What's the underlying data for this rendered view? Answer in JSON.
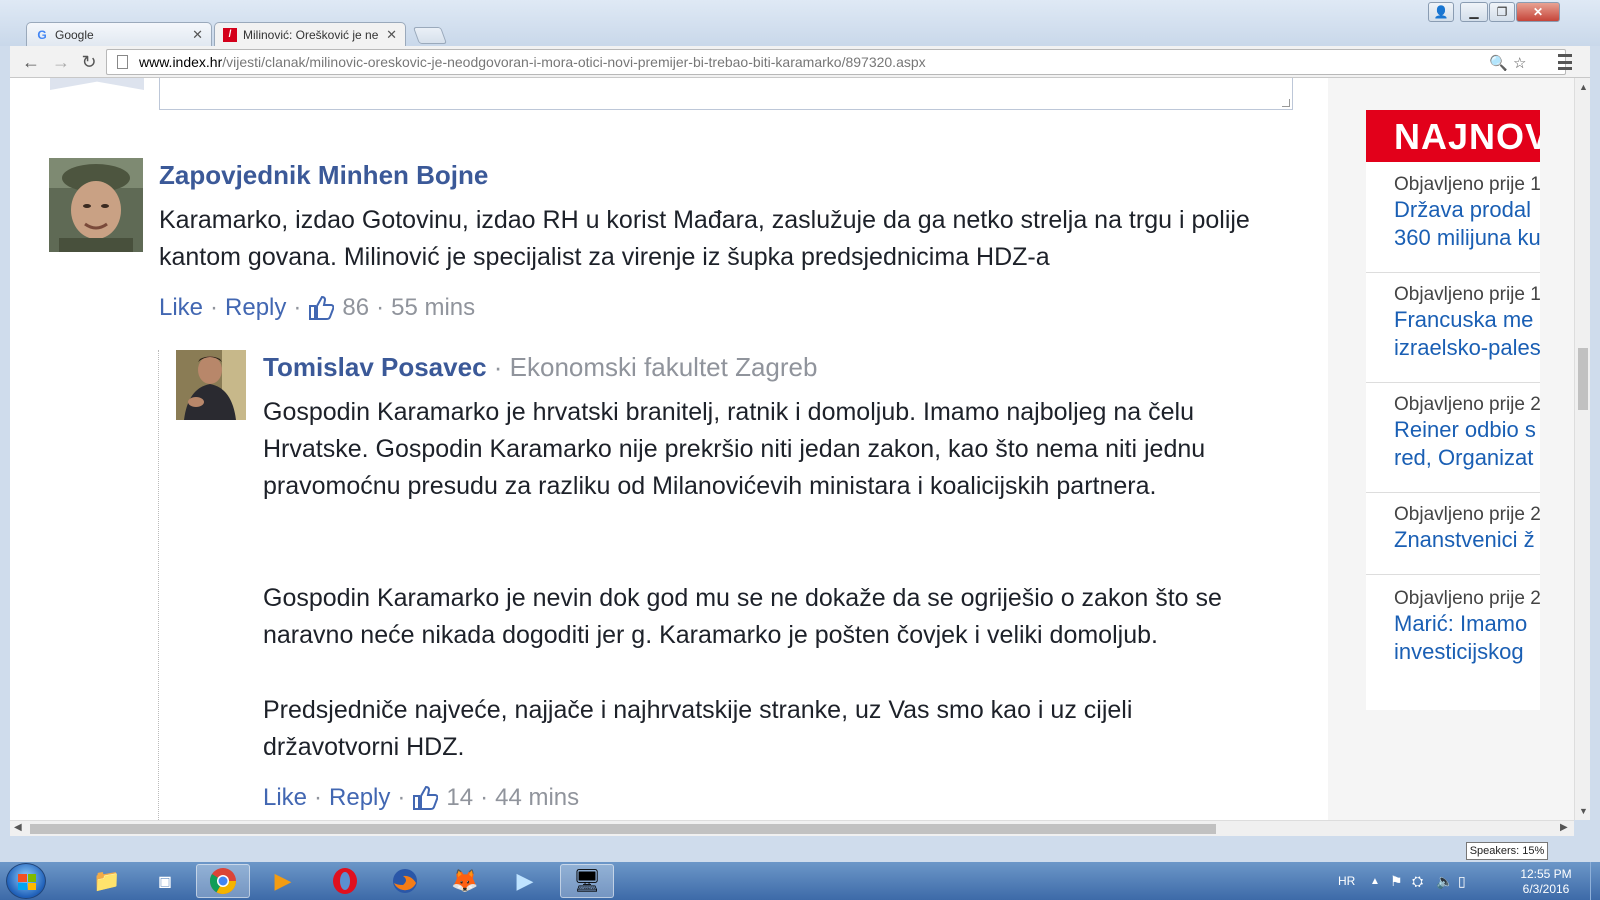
{
  "browser": {
    "tabs": [
      {
        "label": "Google",
        "icon": "google-favicon"
      },
      {
        "label": "Milinović: Orešković je ne",
        "icon": "index-hr-favicon"
      }
    ],
    "url_host": "www.index.hr",
    "url_path": "/vijesti/clanak/milinovic-oreskovic-je-neodgovoran-i-mora-otici-novi-premijer-bi-trebao-biti-karamarko/897320.aspx"
  },
  "comments": [
    {
      "author": "Zapovjednik Minhen Bojne",
      "text": "Karamarko, izdao Gotovinu, izdao RH u korist Mađara, zaslužuje da ga netko strelja na trgu i polije kantom govana. Milinović je specijalist za virenje iz šupka predsjednicima HDZ-a",
      "like": "Like",
      "reply": "Reply",
      "likes": "86",
      "time": "55 mins"
    }
  ],
  "reply": {
    "author": "Tomislav Posavec",
    "affiliation": "Ekonomski fakultet Zagreb",
    "paragraphs": [
      "Gospodin Karamarko je hrvatski branitelj, ratnik i domoljub. Imamo najboljeg na čelu Hrvatske. Gospodin Karamarko nije prekršio niti jedan zakon, kao što nema niti jednu pravomoćnu presudu za razliku od Milanovićevih ministara i koalicijskih partnera.",
      "Gospodin Karamarko je nevin dok god mu se ne dokaže da se ogriješio o zakon što se naravno neće nikada dogoditi jer g. Karamarko je pošten čovjek i veliki domoljub.",
      "Predsjedniče najveće, najjače i najhrvatskije stranke, uz Vas smo kao i uz cijeli državotvorni HDZ."
    ],
    "like": "Like",
    "reply": "Reply",
    "likes": "14",
    "time": "44 mins"
  },
  "sidebar": {
    "header": "NAJNOVIJE",
    "items": [
      {
        "date": "Objavljeno prije 1",
        "title_lines": [
          "Država prodal",
          "360 milijuna ku"
        ]
      },
      {
        "date": "Objavljeno prije 1",
        "title_lines": [
          "Francuska me",
          "izraelsko-pales"
        ]
      },
      {
        "date": "Objavljeno prije 2",
        "title_lines": [
          "Reiner odbio s",
          "red, Organizat"
        ]
      },
      {
        "date": "Objavljeno prije 2",
        "title_lines": [
          "Znanstvenici ž"
        ]
      },
      {
        "date": "Objavljeno prije 2",
        "title_lines": [
          "Marić: Imamo",
          "investicijskog"
        ]
      }
    ]
  },
  "system": {
    "tooltip": "Speakers: 15%",
    "language": "HR",
    "time": "12:55 PM",
    "date": "6/3/2016"
  },
  "taskbar_apps": [
    "file-explorer-icon",
    "media-player-321-icon",
    "chrome-icon",
    "media-player-icon",
    "opera-icon",
    "firefox-icon",
    "gimp-icon",
    "video-player-icon",
    "remote-desktop-icon"
  ],
  "colors": {
    "link_blue": "#3b5998",
    "meta_gray": "#90949c",
    "news_red": "#e2001a",
    "news_link": "#1a5fb4"
  }
}
